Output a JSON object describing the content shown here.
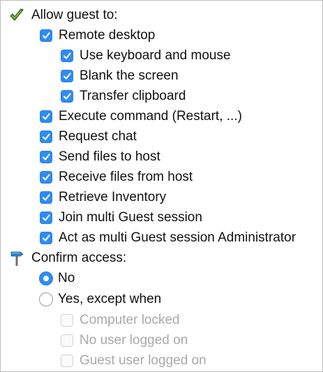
{
  "section_allow": {
    "title": "Allow guest to:",
    "icon": "checkmark-icon",
    "items": [
      {
        "label": "Remote desktop",
        "checked": true
      },
      {
        "label": "Use keyboard and mouse",
        "checked": true
      },
      {
        "label": "Blank the screen",
        "checked": true
      },
      {
        "label": "Transfer clipboard",
        "checked": true
      },
      {
        "label": "Execute command (Restart, ...)",
        "checked": true
      },
      {
        "label": "Request chat",
        "checked": true
      },
      {
        "label": "Send files to host",
        "checked": true
      },
      {
        "label": "Receive files from host",
        "checked": true
      },
      {
        "label": "Retrieve Inventory",
        "checked": true
      },
      {
        "label": "Join multi Guest session",
        "checked": true
      },
      {
        "label": "Act as multi Guest session Administrator",
        "checked": true
      }
    ]
  },
  "section_confirm": {
    "title": "Confirm access:",
    "icon": "signpost-icon",
    "options": [
      {
        "label": "No",
        "selected": true
      },
      {
        "label": "Yes, except when",
        "selected": false
      }
    ],
    "exceptions": [
      {
        "label": "Computer locked",
        "checked": false,
        "enabled": false
      },
      {
        "label": "No user logged on",
        "checked": false,
        "enabled": false
      },
      {
        "label": "Guest user logged on",
        "checked": false,
        "enabled": false
      }
    ]
  },
  "colors": {
    "accent": "#2f8cf3",
    "disabled_text": "#a9a9a9"
  }
}
